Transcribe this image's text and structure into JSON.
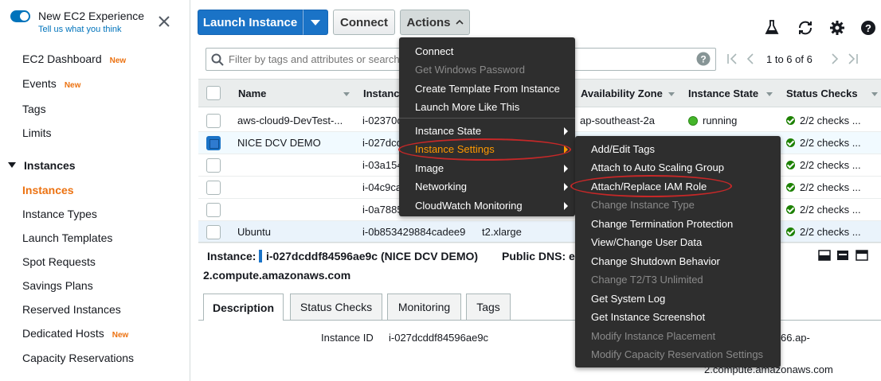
{
  "sidebar": {
    "experience_title": "New EC2 Experience",
    "experience_link": "Tell us what you think",
    "items": [
      {
        "label": "EC2 Dashboard",
        "badge": "New"
      },
      {
        "label": "Events",
        "badge": "New"
      },
      {
        "label": "Tags"
      },
      {
        "label": "Limits"
      },
      {
        "label": "Instances",
        "section": true
      },
      {
        "label": "Instances",
        "active": true
      },
      {
        "label": "Instance Types"
      },
      {
        "label": "Launch Templates"
      },
      {
        "label": "Spot Requests"
      },
      {
        "label": "Savings Plans"
      },
      {
        "label": "Reserved Instances"
      },
      {
        "label": "Dedicated Hosts",
        "badge": "New"
      },
      {
        "label": "Capacity Reservations"
      }
    ]
  },
  "toolbar": {
    "launch_label": "Launch Instance",
    "connect_label": "Connect",
    "actions_label": "Actions"
  },
  "search": {
    "placeholder": "Filter by tags and attributes or search by keyword",
    "pagination": "1 to 6 of 6"
  },
  "table": {
    "columns": [
      "Name",
      "Instance ID",
      "Instance Type",
      "Availability Zone",
      "Instance State",
      "Status Checks"
    ],
    "rows": [
      {
        "name": "aws-cloud9-DevTest-...",
        "id": "i-02370c",
        "type": "",
        "az": "ap-southeast-2a",
        "state": "running",
        "checks": "2/2 checks ..."
      },
      {
        "name": "NICE DCV DEMO",
        "id": "i-027dcd",
        "type": "",
        "az": "",
        "state": "",
        "checks": "2/2 checks ...",
        "selected": true
      },
      {
        "name": "",
        "id": "i-03a154",
        "type": "",
        "az": "",
        "state": "",
        "checks": "2/2 checks ..."
      },
      {
        "name": "",
        "id": "i-04c9ca",
        "type": "",
        "az": "",
        "state": "",
        "checks": "2/2 checks ..."
      },
      {
        "name": "",
        "id": "i-0a7885",
        "type": "",
        "az": "",
        "state": "",
        "checks": "2/2 checks ..."
      },
      {
        "name": "Ubuntu",
        "id": "i-0b853429884cadee9",
        "type": "t2.xlarge",
        "az": "",
        "state": "",
        "checks": "2/2 checks ..."
      }
    ]
  },
  "detail": {
    "instance_label": "Instance:",
    "instance_value": "i-027dcddf84596ae9c (NICE DCV DEMO)",
    "dns_label": "Public DNS: ec",
    "dns_cont": "2.compute.amazonaws.com",
    "tabs": [
      "Description",
      "Status Checks",
      "Monitoring",
      "Tags"
    ],
    "field_label": "Instance ID",
    "field_value": "i-027dcddf84596ae9c",
    "right_frag": "66.ap-",
    "right_frag2": "2.compute.amazonaws.com"
  },
  "actions_menu": {
    "items": [
      "Connect",
      "Get Windows Password",
      "Create Template From Instance",
      "Launch More Like This",
      "Instance State",
      "Instance Settings",
      "Image",
      "Networking",
      "CloudWatch Monitoring"
    ]
  },
  "settings_menu": {
    "items": [
      "Add/Edit Tags",
      "Attach to Auto Scaling Group",
      "Attach/Replace IAM Role",
      "Change Instance Type",
      "Change Termination Protection",
      "View/Change User Data",
      "Change Shutdown Behavior",
      "Change T2/T3 Unlimited",
      "Get System Log",
      "Get Instance Screenshot",
      "Modify Instance Placement",
      "Modify Capacity Reservation Settings"
    ]
  },
  "colors": {
    "accent": "#ec7211",
    "primary": "#1a73c7",
    "menu_bg": "#2e2e2e",
    "highlight": "#ff9900",
    "annotation": "#c62828"
  }
}
